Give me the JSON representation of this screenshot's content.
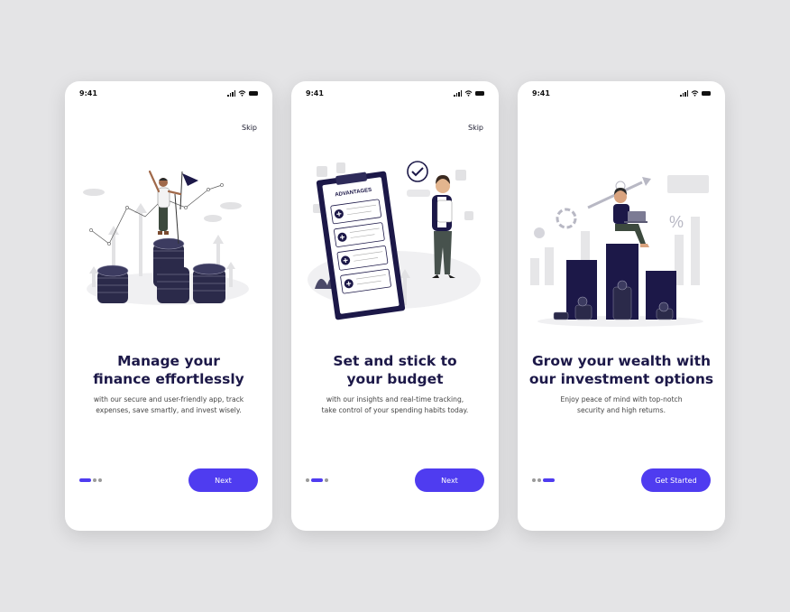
{
  "colors": {
    "background": "#e4e4e6",
    "card": "#ffffff",
    "accent": "#4f3cf0",
    "navy": "#1c1848",
    "illustration_gray": "#e0e0e2",
    "coin_dark": "#2b2a4a"
  },
  "screens": [
    {
      "status_time": "9:41",
      "skip_label": "Skip",
      "illustration": "person-on-coin-stacks-with-flag",
      "title_line1": "Manage your",
      "title_line2": "finance effortlessly",
      "desc_line1": "with our secure and user-friendly app, track",
      "desc_line2": "expenses, save smartly, and invest wisely.",
      "active_dot": 0,
      "button_label": "Next"
    },
    {
      "status_time": "9:41",
      "skip_label": "Skip",
      "illustration": "woman-with-advantages-clipboard",
      "clipboard_heading": "ADVANTAGES",
      "title_line1": "Set and stick to",
      "title_line2": "your budget",
      "desc_line1": "with our insights and real-time tracking,",
      "desc_line2": "take control of your spending habits today.",
      "active_dot": 1,
      "button_label": "Next"
    },
    {
      "status_time": "9:41",
      "illustration": "man-with-laptop-on-bar-chart",
      "title_line1": "Grow your wealth with",
      "title_line2": "our investment options",
      "desc_line1": "Enjoy peace of mind with top-notch",
      "desc_line2": "security and high returns.",
      "active_dot": 2,
      "button_label": "Get Started"
    }
  ]
}
